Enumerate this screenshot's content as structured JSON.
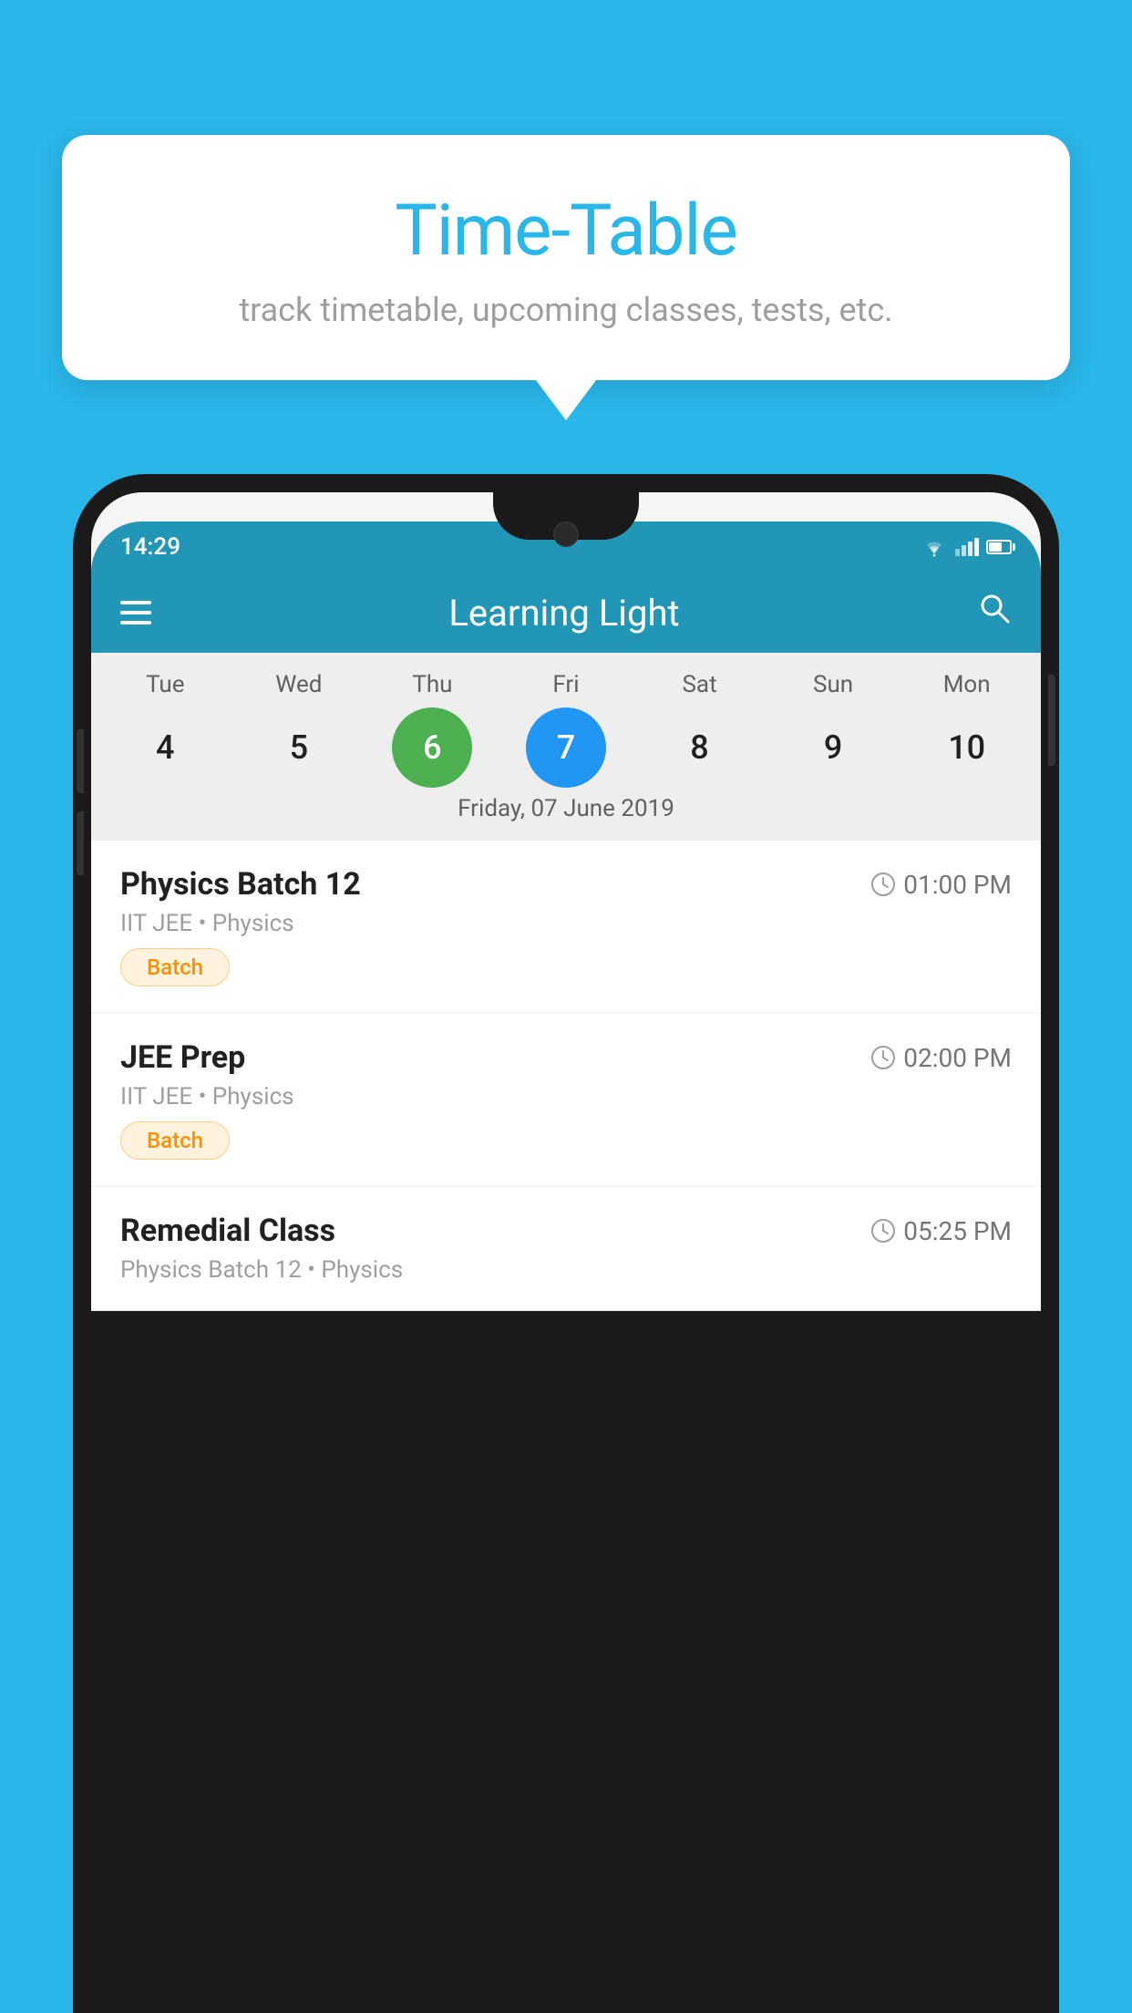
{
  "background_color": "#29b6e8",
  "tooltip": {
    "title": "Time-Table",
    "subtitle": "track timetable, upcoming classes, tests, etc."
  },
  "phone": {
    "status_bar": {
      "time": "14:29"
    },
    "app_header": {
      "title": "Learning Light"
    },
    "calendar": {
      "days": [
        "Tue",
        "Wed",
        "Thu",
        "Fri",
        "Sat",
        "Sun",
        "Mon"
      ],
      "dates": [
        "4",
        "5",
        "6",
        "7",
        "8",
        "9",
        "10"
      ],
      "today_index": 2,
      "selected_index": 3,
      "selected_label": "Friday, 07 June 2019"
    },
    "schedule": [
      {
        "name": "Physics Batch 12",
        "time": "01:00 PM",
        "meta": "IIT JEE • Physics",
        "tag": "Batch"
      },
      {
        "name": "JEE Prep",
        "time": "02:00 PM",
        "meta": "IIT JEE • Physics",
        "tag": "Batch"
      },
      {
        "name": "Remedial Class",
        "time": "05:25 PM",
        "meta": "Physics Batch 12 • Physics",
        "tag": ""
      }
    ]
  }
}
